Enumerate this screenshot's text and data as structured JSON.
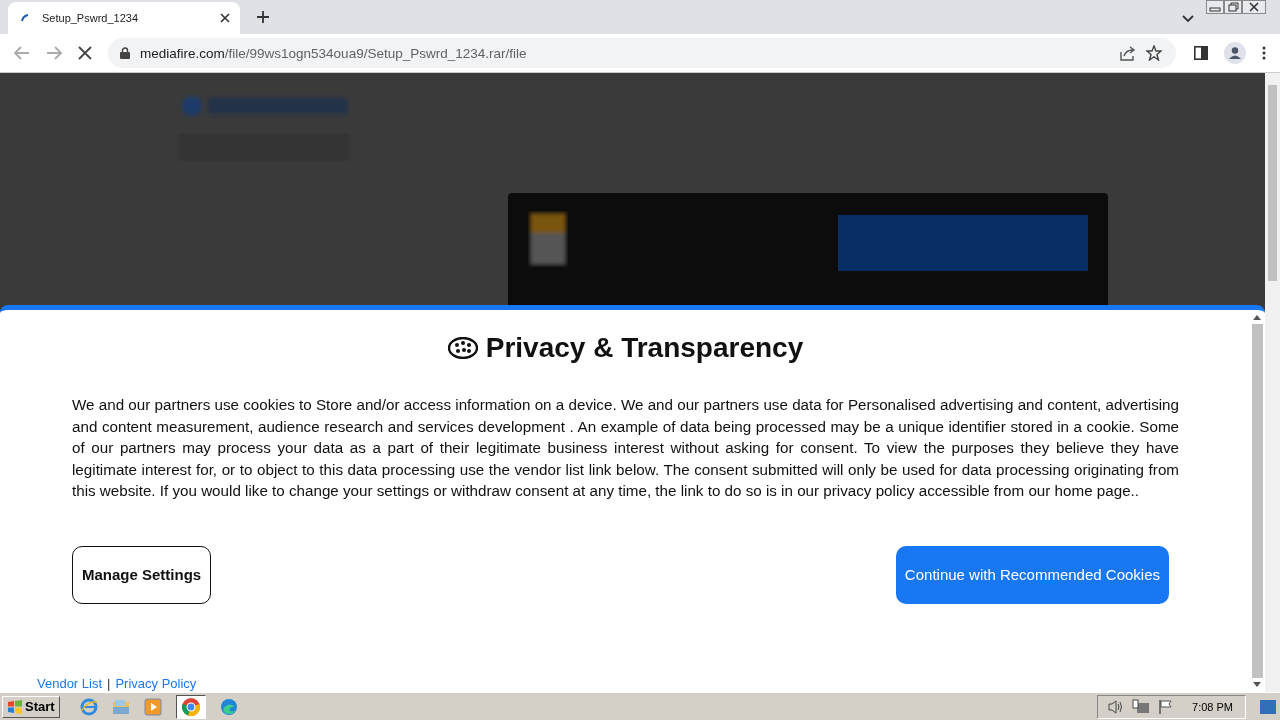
{
  "browser": {
    "tab": {
      "title": "Setup_Pswrd_1234"
    },
    "url": {
      "host": "mediafire.com",
      "path": "/file/99ws1ogn534oua9/Setup_Pswrd_1234.rar/file"
    }
  },
  "dialog": {
    "title": "Privacy & Transparency",
    "body": "We and our partners use cookies to Store and/or access information on a device. We and our partners use data for Personalised advertising and content, advertising and content measurement, audience research and services development . An example of data being processed may be a unique identifier stored in a cookie. Some of our partners may process your data as a part of their legitimate business interest without asking for consent. To view the purposes they believe they have legitimate interest for, or to object to this data processing use the vendor list link below. The consent submitted will only be used for data processing originating from this website. If you would like to change your settings or withdraw consent at any time, the link to do so is in our privacy policy accessible from our home page..",
    "buttons": [
      {
        "label": "Manage Settings",
        "kind": "secondary"
      },
      {
        "label": "Continue with Recommended Cookies",
        "kind": "primary"
      }
    ],
    "links": [
      "Vendor List",
      "Privacy Policy"
    ],
    "link_separator": "|"
  },
  "taskbar": {
    "start": "Start",
    "clock": "7:08 PM"
  }
}
